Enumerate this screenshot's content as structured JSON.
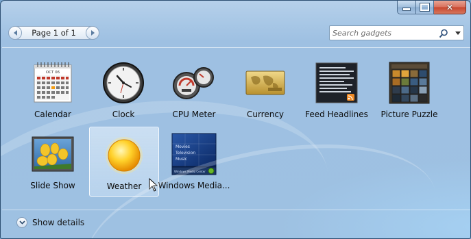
{
  "window": {
    "caption": {
      "minimize": "minimize",
      "maximize": "maximize",
      "close": "✕"
    }
  },
  "toolbar": {
    "pager_label": "Page 1 of 1",
    "search_placeholder": "Search gadgets"
  },
  "gadgets": [
    {
      "label": "Calendar",
      "icon": "calendar-icon"
    },
    {
      "label": "Clock",
      "icon": "clock-icon"
    },
    {
      "label": "CPU Meter",
      "icon": "cpu-meter-icon"
    },
    {
      "label": "Currency",
      "icon": "currency-icon"
    },
    {
      "label": "Feed Headlines",
      "icon": "feed-headlines-icon"
    },
    {
      "label": "Picture Puzzle",
      "icon": "picture-puzzle-icon"
    },
    {
      "label": "Slide Show",
      "icon": "slide-show-icon"
    },
    {
      "label": "Weather",
      "icon": "weather-icon",
      "selected": true
    },
    {
      "label": "Windows Media...",
      "icon": "windows-media-center-icon"
    }
  ],
  "calendar_icon": {
    "month": "OCT 06"
  },
  "media_icon": {
    "lines": [
      "Movies",
      "Television",
      "Music"
    ],
    "footer": "Windows Media Center"
  },
  "footer": {
    "details_label": "Show details"
  },
  "colors": {
    "accent": "#1f5a96",
    "selection": "#dcebfb"
  }
}
